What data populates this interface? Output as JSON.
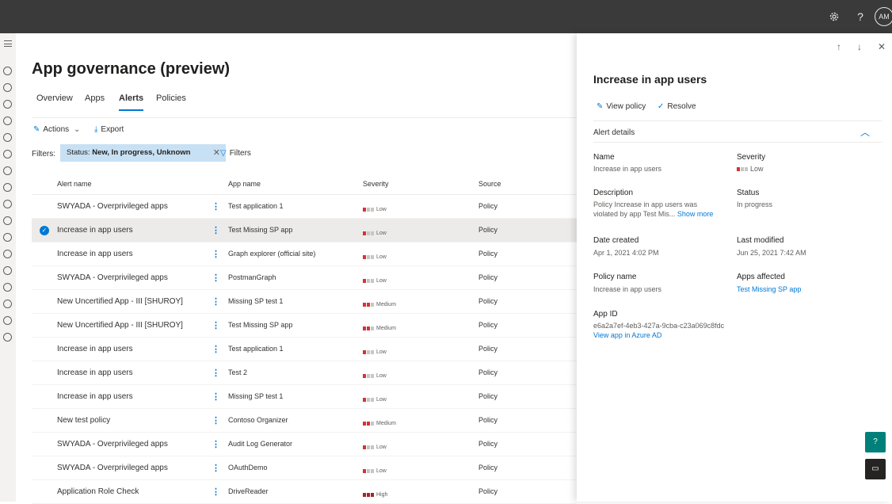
{
  "topbar": {
    "settings_icon": "gear-icon",
    "help_icon": "help-icon",
    "help_glyph": "?",
    "avatar_initials": "AM"
  },
  "page": {
    "title": "App governance (preview)"
  },
  "tabs": [
    {
      "label": "Overview",
      "active": false
    },
    {
      "label": "Apps",
      "active": false
    },
    {
      "label": "Alerts",
      "active": true
    },
    {
      "label": "Policies",
      "active": false
    }
  ],
  "toolbar": {
    "actions_label": "Actions",
    "export_label": "Export"
  },
  "filters": {
    "label": "Filters:",
    "chip_key": "Status:",
    "chip_value": "New, In progress, Unknown",
    "filters_button": "Filters"
  },
  "table": {
    "headers": {
      "alert_name": "Alert name",
      "app_name": "App name",
      "severity": "Severity",
      "source": "Source"
    },
    "rows": [
      {
        "alert": "SWYADA - Overprivileged apps",
        "app": "Test application 1",
        "severity": "Low",
        "source": "Policy",
        "selected": false
      },
      {
        "alert": "Increase in app users",
        "app": "Test Missing SP app",
        "severity": "Low",
        "source": "Policy",
        "selected": true
      },
      {
        "alert": "Increase in app users",
        "app": "Graph explorer (official site)",
        "severity": "Low",
        "source": "Policy",
        "selected": false
      },
      {
        "alert": "SWYADA - Overprivileged apps",
        "app": "PostmanGraph",
        "severity": "Low",
        "source": "Policy",
        "selected": false
      },
      {
        "alert": "New Uncertified App - III [SHUROY]",
        "app": "Missing SP test 1",
        "severity": "Medium",
        "source": "Policy",
        "selected": false
      },
      {
        "alert": "New Uncertified App - III [SHUROY]",
        "app": "Test Missing SP app",
        "severity": "Medium",
        "source": "Policy",
        "selected": false
      },
      {
        "alert": "Increase in app users",
        "app": "Test application 1",
        "severity": "Low",
        "source": "Policy",
        "selected": false
      },
      {
        "alert": "Increase in app users",
        "app": "Test 2",
        "severity": "Low",
        "source": "Policy",
        "selected": false
      },
      {
        "alert": "Increase in app users",
        "app": "Missing SP test 1",
        "severity": "Low",
        "source": "Policy",
        "selected": false
      },
      {
        "alert": "New test policy",
        "app": "Contoso Organizer",
        "severity": "Medium",
        "source": "Policy",
        "selected": false
      },
      {
        "alert": "SWYADA - Overprivileged apps",
        "app": "Audit Log Generator",
        "severity": "Low",
        "source": "Policy",
        "selected": false
      },
      {
        "alert": "SWYADA - Overprivileged apps",
        "app": "OAuthDemo",
        "severity": "Low",
        "source": "Policy",
        "selected": false
      },
      {
        "alert": "Application Role Check",
        "app": "DriveReader",
        "severity": "High",
        "source": "Policy",
        "selected": false
      }
    ]
  },
  "panel": {
    "title": "Increase in app users",
    "view_policy": "View policy",
    "resolve": "Resolve",
    "section": "Alert details",
    "name_label": "Name",
    "name_value": "Increase in app users",
    "severity_label": "Severity",
    "severity_value": "Low",
    "description_label": "Description",
    "description_line1": "Policy Increase in app users was",
    "description_line2": "violated by app Test Mis...",
    "show_more": "Show more",
    "status_label": "Status",
    "status_value": "In progress",
    "date_created_label": "Date created",
    "date_created_value": "Apr 1, 2021 4:02 PM",
    "last_modified_label": "Last modified",
    "last_modified_value": "Jun 25, 2021 7:42 AM",
    "policy_name_label": "Policy name",
    "policy_name_value": "Increase in app users",
    "apps_affected_label": "Apps affected",
    "apps_affected_value": "Test Missing SP app",
    "app_id_label": "App ID",
    "app_id_value": "e6a2a7ef-4eb3-427a-9cba-c23a069c8fdc",
    "view_in_azure": "View app in Azure AD"
  },
  "colors": {
    "accent": "#0078d4",
    "severity_low": "#d13438",
    "severity_inactive": "#c8c6c4",
    "severity_medium": "#d13438",
    "severity_high": "#a4262c"
  }
}
